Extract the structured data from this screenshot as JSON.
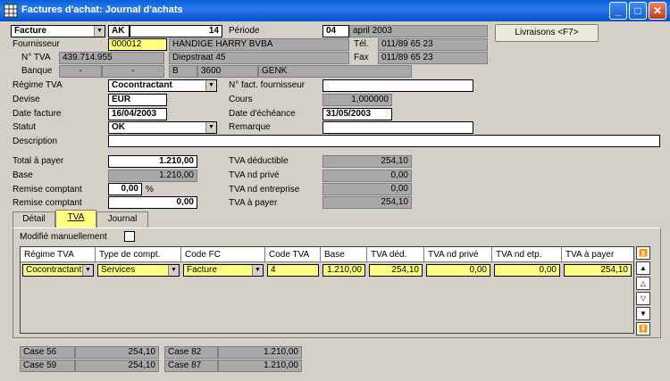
{
  "window": {
    "title": "Factures d'achat: Journal d'achats",
    "minimize": "_",
    "maximize": "□",
    "close": "✕",
    "icon": "grid-app-icon"
  },
  "header": {
    "doc_type": "Facture",
    "journal": "AK",
    "number": "14",
    "periode_label": "Période",
    "periode_num": "04",
    "periode_text": "april 2003",
    "livraisons_button": "Livraisons <F7>"
  },
  "supplier": {
    "fournisseur_label": "Fournisseur",
    "code": "000012",
    "name": "HANDIGE HARRY BVBA",
    "tel_label": "Tél.",
    "tel": "011/89 65 23",
    "tva_label": "N° TVA",
    "tva": "439.714.955",
    "street": "Diepstraat 45",
    "fax_label": "Fax",
    "fax": "011/89 65 23",
    "banque_label": "Banque",
    "bank_a": "-",
    "bank_b": "-",
    "country": "B",
    "zip": "3600",
    "city": "GENK"
  },
  "form": {
    "regime_label": "Régime TVA",
    "regime": "Cocontractant",
    "nfact_label": "N° fact. fournisseur",
    "nfact": "",
    "devise_label": "Devise",
    "devise": "EUR",
    "cours_label": "Cours",
    "cours": "1,000000",
    "date_facture_label": "Date facture",
    "date_facture": "16/04/2003",
    "date_echeance_label": "Date d'échéance",
    "date_echeance": "31/05/2003",
    "statut_label": "Statut",
    "statut": "OK",
    "remarque_label": "Remarque",
    "remarque": "",
    "description_label": "Description",
    "description": ""
  },
  "totals": {
    "total_label": "Total à payer",
    "total": "1.210,00",
    "base_label": "Base",
    "base": "1.210,00",
    "remise_label": "Remise comptant",
    "remise_pct": "0,00",
    "pct_sign": "%",
    "remise2_label": "Remise comptant",
    "remise_amt": "0,00",
    "tva_ded_label": "TVA déductible",
    "tva_ded": "254,10",
    "tva_nd_prive_label": "TVA nd privé",
    "tva_nd_prive": "0,00",
    "tva_nd_ent_label": "TVA nd entreprise",
    "tva_nd_ent": "0,00",
    "tva_payer_label": "TVA à payer",
    "tva_payer": "254,10"
  },
  "tabs": [
    {
      "label": "Détail"
    },
    {
      "label": "TVA"
    },
    {
      "label": "Journal"
    }
  ],
  "tva_panel": {
    "modifie_label": "Modifié manuellement",
    "columns": [
      "Régime TVA",
      "Type de compt.",
      "Code FC",
      "Code TVA",
      "Base",
      "TVA déd.",
      "TVA nd privé",
      "TVA nd etp.",
      "TVA à payer"
    ],
    "row": [
      "Cocontractant",
      "Services",
      "Facture",
      "4",
      "1.210,00",
      "254,10",
      "0,00",
      "0,00",
      "254,10"
    ]
  },
  "cases": [
    {
      "label": "Case 56",
      "value": "254,10"
    },
    {
      "label": "Case 82",
      "value": "1.210,00"
    },
    {
      "label": "Case 59",
      "value": "254,10"
    },
    {
      "label": "Case 87",
      "value": "1.210,00"
    }
  ]
}
